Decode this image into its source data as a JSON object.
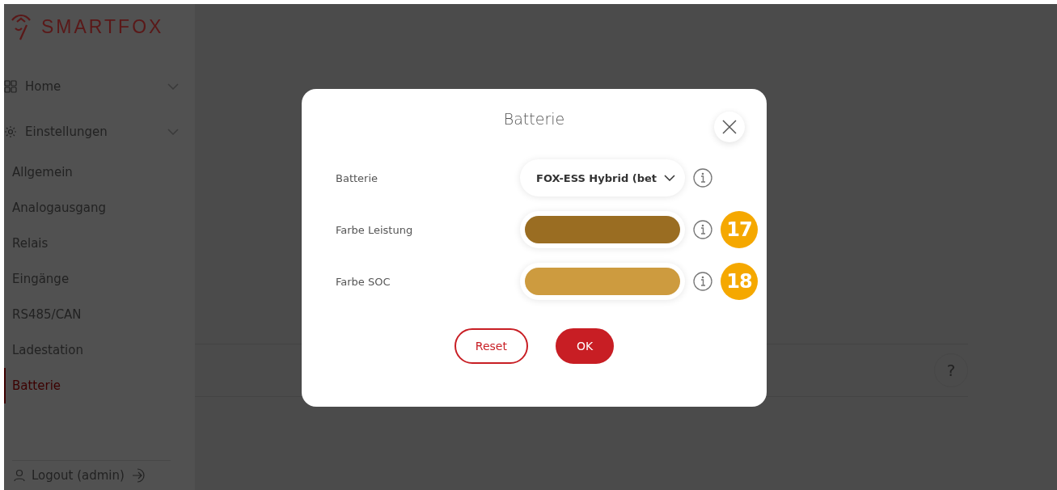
{
  "sidebar": {
    "logo": "SMARTFOX",
    "groups": [
      {
        "label": "Home"
      },
      {
        "label": "Einstellungen"
      }
    ],
    "items": [
      {
        "label": "Allgemein",
        "selected": false
      },
      {
        "label": "Analogausgang",
        "selected": false
      },
      {
        "label": "Relais",
        "selected": false
      },
      {
        "label": "Eingänge",
        "selected": false
      },
      {
        "label": "RS485/CAN",
        "selected": false
      },
      {
        "label": "Ladestation",
        "selected": false
      },
      {
        "label": "Batterie",
        "selected": true
      }
    ],
    "logout": "Logout (admin)"
  },
  "main": {
    "help_button": "?"
  },
  "modal": {
    "title": "Batterie",
    "fields": [
      {
        "kind": "select",
        "label": "Batterie",
        "value": "FOX-ESS Hybrid (bet"
      },
      {
        "kind": "color",
        "label": "Farbe Leistung",
        "color": "#9a6d22",
        "badge": "17"
      },
      {
        "kind": "color",
        "label": "Farbe SOC",
        "color": "#cd9b3f",
        "badge": "18"
      }
    ],
    "buttons": [
      {
        "kind": "secondary",
        "label": "Reset"
      },
      {
        "kind": "primary",
        "label": "OK"
      }
    ]
  }
}
